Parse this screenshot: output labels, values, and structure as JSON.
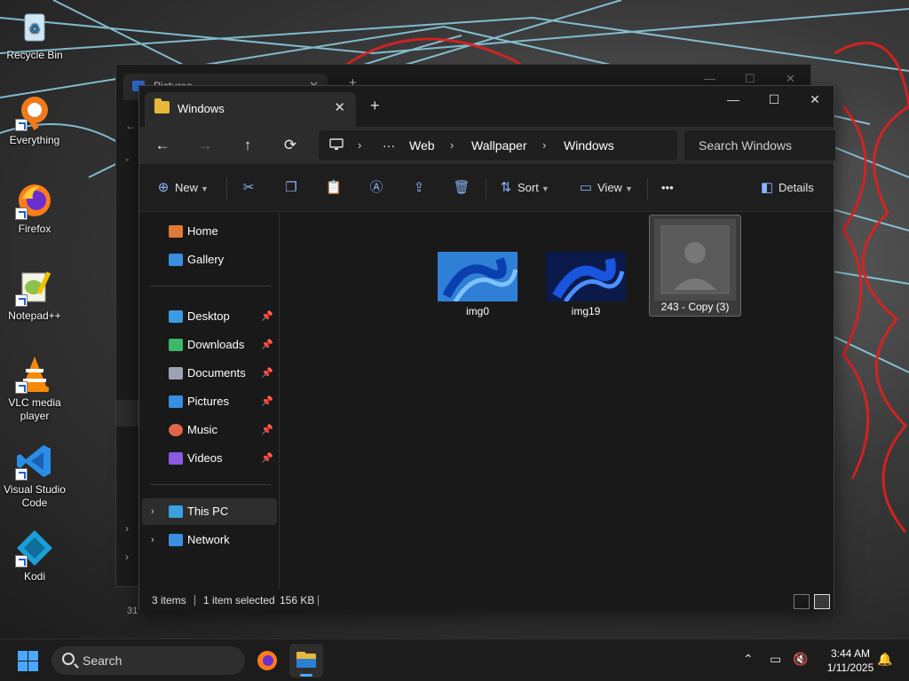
{
  "desktop": {
    "icons": [
      {
        "label": "Recycle Bin",
        "icon": "recycle-bin-icon"
      },
      {
        "label": "Everything",
        "icon": "everything-search-icon"
      },
      {
        "label": "Firefox",
        "icon": "firefox-icon"
      },
      {
        "label": "Notepad++",
        "icon": "notepadpp-icon"
      },
      {
        "label": "VLC media player",
        "icon": "vlc-icon"
      },
      {
        "label": "Visual Studio Code",
        "icon": "vscode-icon"
      },
      {
        "label": "Kodi",
        "icon": "kodi-icon"
      }
    ]
  },
  "back_window": {
    "tab_title": "Pictures",
    "status_fragment": "31"
  },
  "window": {
    "tab_title": "Windows",
    "controls": {
      "minimize": "—",
      "maximize": "☐",
      "close": "✕"
    },
    "nav": {
      "back": "←",
      "forward": "→",
      "up": "↑",
      "refresh": "⟳"
    },
    "breadcrumb": [
      "Web",
      "Wallpaper",
      "Windows"
    ],
    "search_placeholder": "Search Windows",
    "commands": {
      "new": "New",
      "sort": "Sort",
      "view": "View",
      "more": "•••",
      "details": "Details"
    },
    "navpane": {
      "quick": [
        {
          "label": "Home",
          "color": "#e07a3a"
        },
        {
          "label": "Gallery",
          "color": "#3a8ee0"
        }
      ],
      "pinned": [
        {
          "label": "Desktop",
          "color": "#3a9be0"
        },
        {
          "label": "Downloads",
          "color": "#3fb86a"
        },
        {
          "label": "Documents",
          "color": "#9aa3b2"
        },
        {
          "label": "Pictures",
          "color": "#3a8ee0"
        },
        {
          "label": "Music",
          "color": "#e0664a"
        },
        {
          "label": "Videos",
          "color": "#8a5ae0"
        }
      ],
      "locations": [
        {
          "label": "This PC",
          "color": "#3aa0e0"
        },
        {
          "label": "Network",
          "color": "#3a8ee0"
        }
      ],
      "pin_glyph": "📌"
    },
    "files": [
      {
        "name": "img0",
        "selected": false
      },
      {
        "name": "img19",
        "selected": false
      },
      {
        "name": "243 - Copy (3)",
        "selected": true
      }
    ],
    "status": {
      "item_count": "3 items",
      "selection": "1 item selected",
      "size": "156 KB"
    }
  },
  "taskbar": {
    "search_label": "Search",
    "time": "3:44 AM",
    "date": "1/11/2025",
    "accent": "#4aa8ff"
  }
}
